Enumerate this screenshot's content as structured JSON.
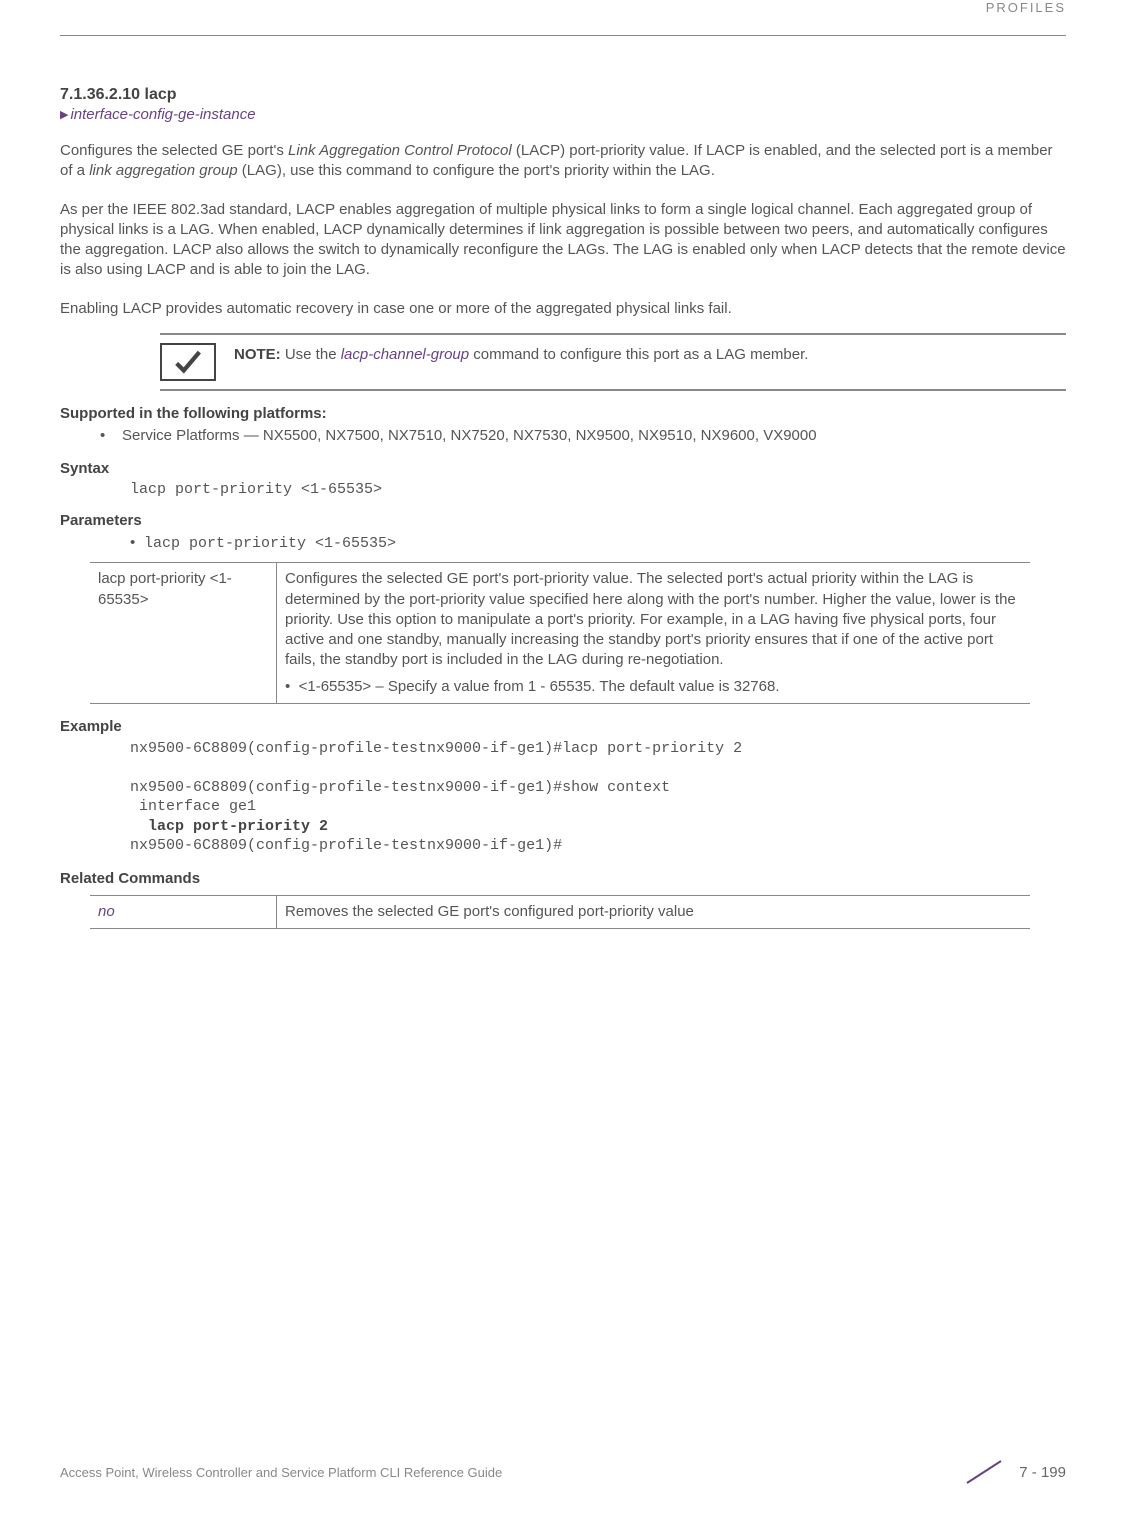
{
  "header": {
    "category": "PROFILES"
  },
  "section": {
    "number": "7.1.36.2.10",
    "title": "lacp",
    "breadcrumb": "interface-config-ge-instance"
  },
  "paragraphs": {
    "p1_a": "Configures the selected GE port's ",
    "p1_em1": "Link Aggregation Control Protocol",
    "p1_b": " (LACP) port-priority value. If LACP is enabled, and the selected port is a member of a ",
    "p1_em2": "link aggregation group",
    "p1_c": " (LAG), use this command to configure the port's priority within the LAG.",
    "p2": "As per the IEEE 802.3ad standard, LACP enables aggregation of multiple physical links to form a single logical channel. Each aggregated group of physical links is a LAG. When enabled, LACP dynamically determines if link aggregation is possible between two peers, and automatically configures the aggregation. LACP also allows the switch to dynamically reconfigure the LAGs. The LAG is enabled only when LACP detects that the remote device is also using LACP and is able to join the LAG.",
    "p3": "Enabling LACP provides automatic recovery in case one or more of the aggregated physical links fail."
  },
  "note": {
    "label": "NOTE:",
    "before": " Use the ",
    "cmd": "lacp-channel-group",
    "after": " command to configure this port as a LAG member."
  },
  "headings": {
    "supported": "Supported in the following platforms:",
    "syntax": "Syntax",
    "parameters": "Parameters",
    "example": "Example",
    "related": "Related Commands"
  },
  "supported": {
    "bullet": "•",
    "text": "Service Platforms — NX5500, NX7500, NX7510, NX7520, NX7530, NX9500, NX9510, NX9600, VX9000"
  },
  "syntax": {
    "code": "lacp port-priority <1-65535>"
  },
  "parameters": {
    "bullet": "•",
    "code": "lacp port-priority <1-65535>",
    "table": {
      "left": "lacp port-priority <1-65535>",
      "right_main": "Configures the selected GE port's port-priority value. The selected port's actual priority within the LAG is determined by the port-priority value specified here along with the port's number. Higher the value, lower is the priority. Use this option to manipulate a port's priority. For example, in a LAG having five physical ports, four active and one standby, manually increasing the standby port's priority ensures that if one of the active port fails, the standby port is included in the LAG during re-negotiation.",
      "right_sub_bullet": "•",
      "right_sub": "<1-65535> – Specify a value from 1 - 65535. The default value is 32768."
    }
  },
  "example": {
    "line1": "nx9500-6C8809(config-profile-testnx9000-if-ge1)#lacp port-priority 2",
    "line2": "nx9500-6C8809(config-profile-testnx9000-if-ge1)#show context",
    "line3": " interface ge1",
    "line4": "  lacp port-priority 2",
    "line5": "nx9500-6C8809(config-profile-testnx9000-if-ge1)#"
  },
  "related": {
    "left": "no",
    "right": "Removes the selected GE port's configured port-priority value"
  },
  "footer": {
    "doc_title": "Access Point, Wireless Controller and Service Platform CLI Reference Guide",
    "page": "7 - 199"
  }
}
